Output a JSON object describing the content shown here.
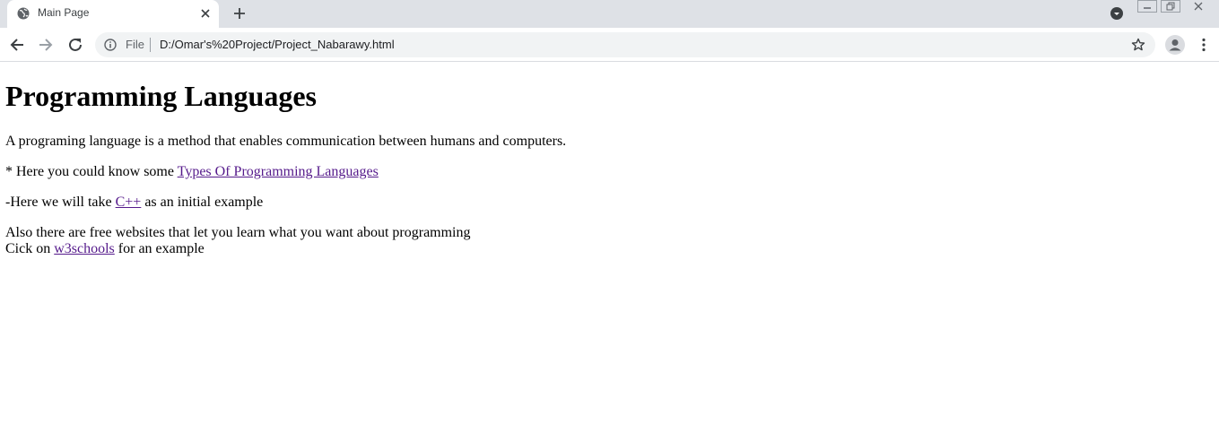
{
  "browser": {
    "tab": {
      "title": "Main Page"
    },
    "address_bar": {
      "scheme_label": "File",
      "url": "D:/Omar's%20Project/Project_Nabarawy.html"
    }
  },
  "page": {
    "heading": "Programming Languages",
    "intro": "A programing language is a method that enables communication between humans and computers.",
    "types_line": {
      "prefix": "* Here you could know some ",
      "link_text": "Types Of Programming Languages"
    },
    "example_line": {
      "prefix": "-Here we will take ",
      "link_text": "C++",
      "suffix": " as an initial example"
    },
    "websites_line": {
      "text": "Also there are free websites that let you learn what you want about programming",
      "prefix": "Cick on ",
      "link_text": "w3schools",
      "suffix": " for an example"
    }
  },
  "colors": {
    "visited_link": "#551a8b",
    "tabstrip_bg": "#dee1e6",
    "omnibox_bg": "#f1f3f4"
  }
}
